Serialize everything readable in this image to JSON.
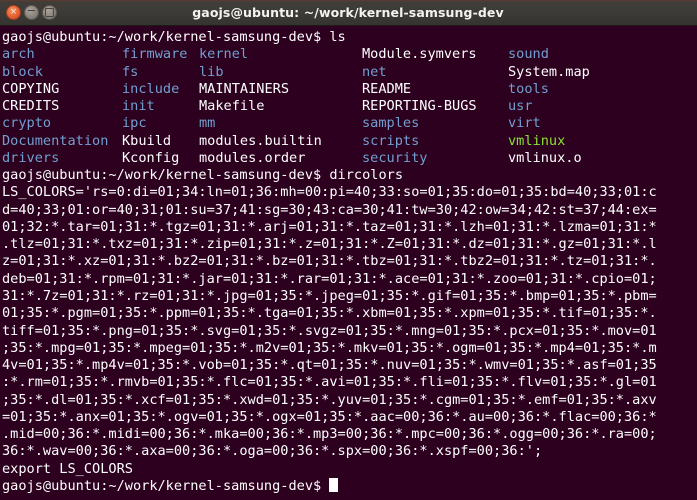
{
  "window": {
    "title": "gaojs@ubuntu: ~/work/kernel-samsung-dev",
    "controls": {
      "close_label": "×",
      "minimize_label": "−",
      "maximize_label": ""
    },
    "colors": {
      "background": "#2c001e",
      "titlebar": "#3c3b37",
      "text": "#ffffff",
      "directory": "#729fcf",
      "executable": "#8ae234",
      "close_button": "#e8663a"
    }
  },
  "terminal": {
    "prompt": "gaojs@ubuntu:~/work/kernel-samsung-dev$",
    "commands": {
      "ls": "ls",
      "dircolors": "dircolors"
    },
    "ls_output_rows": [
      [
        {
          "text": "arch",
          "color": "blue"
        },
        {
          "text": "firmware",
          "color": "blue"
        },
        {
          "text": "kernel",
          "color": "blue"
        },
        {
          "text": "Module.symvers",
          "color": "white"
        },
        {
          "text": "sound",
          "color": "blue"
        }
      ],
      [
        {
          "text": "block",
          "color": "blue"
        },
        {
          "text": "fs",
          "color": "blue"
        },
        {
          "text": "lib",
          "color": "blue"
        },
        {
          "text": "net",
          "color": "blue"
        },
        {
          "text": "System.map",
          "color": "white"
        }
      ],
      [
        {
          "text": "COPYING",
          "color": "white"
        },
        {
          "text": "include",
          "color": "blue"
        },
        {
          "text": "MAINTAINERS",
          "color": "white"
        },
        {
          "text": "README",
          "color": "white"
        },
        {
          "text": "tools",
          "color": "blue"
        }
      ],
      [
        {
          "text": "CREDITS",
          "color": "white"
        },
        {
          "text": "init",
          "color": "blue"
        },
        {
          "text": "Makefile",
          "color": "white"
        },
        {
          "text": "REPORTING-BUGS",
          "color": "white"
        },
        {
          "text": "usr",
          "color": "blue"
        }
      ],
      [
        {
          "text": "crypto",
          "color": "blue"
        },
        {
          "text": "ipc",
          "color": "blue"
        },
        {
          "text": "mm",
          "color": "blue"
        },
        {
          "text": "samples",
          "color": "blue"
        },
        {
          "text": "virt",
          "color": "blue"
        }
      ],
      [
        {
          "text": "Documentation",
          "color": "blue"
        },
        {
          "text": "Kbuild",
          "color": "white"
        },
        {
          "text": "modules.builtin",
          "color": "white"
        },
        {
          "text": "scripts",
          "color": "blue"
        },
        {
          "text": "vmlinux",
          "color": "green"
        }
      ],
      [
        {
          "text": "drivers",
          "color": "blue"
        },
        {
          "text": "Kconfig",
          "color": "white"
        },
        {
          "text": "modules.order",
          "color": "white"
        },
        {
          "text": "security",
          "color": "blue"
        },
        {
          "text": "vmlinux.o",
          "color": "white"
        }
      ]
    ],
    "dircolors_output_lines": [
      "LS_COLORS='rs=0:di=01;34:ln=01;36:mh=00:pi=40;33:so=01;35:do=01;35:bd=40;33;01:c",
      "d=40;33;01:or=40;31;01:su=37;41:sg=30;43:ca=30;41:tw=30;42:ow=34;42:st=37;44:ex=",
      "01;32:*.tar=01;31:*.tgz=01;31:*.arj=01;31:*.taz=01;31:*.lzh=01;31:*.lzma=01;31:*",
      ".tlz=01;31:*.txz=01;31:*.zip=01;31:*.z=01;31:*.Z=01;31:*.dz=01;31:*.gz=01;31:*.l",
      "z=01;31:*.xz=01;31:*.bz2=01;31:*.bz=01;31:*.tbz=01;31:*.tbz2=01;31:*.tz=01;31:*.",
      "deb=01;31:*.rpm=01;31:*.jar=01;31:*.rar=01;31:*.ace=01;31:*.zoo=01;31:*.cpio=01;",
      "31:*.7z=01;31:*.rz=01;31:*.jpg=01;35:*.jpeg=01;35:*.gif=01;35:*.bmp=01;35:*.pbm=",
      "01;35:*.pgm=01;35:*.ppm=01;35:*.tga=01;35:*.xbm=01;35:*.xpm=01;35:*.tif=01;35:*.",
      "tiff=01;35:*.png=01;35:*.svg=01;35:*.svgz=01;35:*.mng=01;35:*.pcx=01;35:*.mov=01",
      ";35:*.mpg=01;35:*.mpeg=01;35:*.m2v=01;35:*.mkv=01;35:*.ogm=01;35:*.mp4=01;35:*.m",
      "4v=01;35:*.mp4v=01;35:*.vob=01;35:*.qt=01;35:*.nuv=01;35:*.wmv=01;35:*.asf=01;35",
      ":*.rm=01;35:*.rmvb=01;35:*.flc=01;35:*.avi=01;35:*.fli=01;35:*.flv=01;35:*.gl=01",
      ";35:*.dl=01;35:*.xcf=01;35:*.xwd=01;35:*.yuv=01;35:*.cgm=01;35:*.emf=01;35:*.axv",
      "=01;35:*.anx=01;35:*.ogv=01;35:*.ogx=01;35:*.aac=00;36:*.au=00;36:*.flac=00;36:*",
      ".mid=00;36:*.midi=00;36:*.mka=00;36:*.mp3=00;36:*.mpc=00;36:*.ogg=00;36:*.ra=00;",
      "36:*.wav=00;36:*.axa=00;36:*.oga=00;36:*.spx=00;36:*.xspf=00;36:';",
      "export LS_COLORS"
    ]
  }
}
